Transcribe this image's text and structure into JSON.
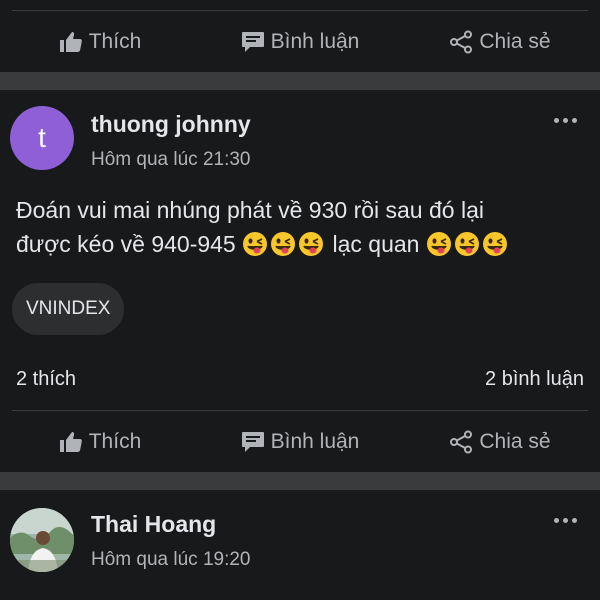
{
  "actions_top": {
    "like": "Thích",
    "comment": "Bình luận",
    "share": "Chia sẻ"
  },
  "post1": {
    "avatar_letter": "t",
    "author": "thuong johnny",
    "time": "Hôm qua lúc 21:30",
    "text_line1": "Đoán vui mai nhúng phát về 930 rồi sau đó lại",
    "text_line2_a": "được kéo về 940-945",
    "text_line2_b": "lạc quan",
    "emoji": "😜",
    "tag": "VNINDEX",
    "likes": "2 thích",
    "comments": "2 bình luận",
    "actions": {
      "like": "Thích",
      "comment": "Bình luận",
      "share": "Chia sẻ"
    }
  },
  "post2": {
    "author": "Thai Hoang",
    "time": "Hôm qua lúc 19:20"
  },
  "colors": {
    "background": "#18191a",
    "separator": "#3a3b3c",
    "avatar": "#8e5fd6",
    "muted": "#b0b3b8"
  }
}
